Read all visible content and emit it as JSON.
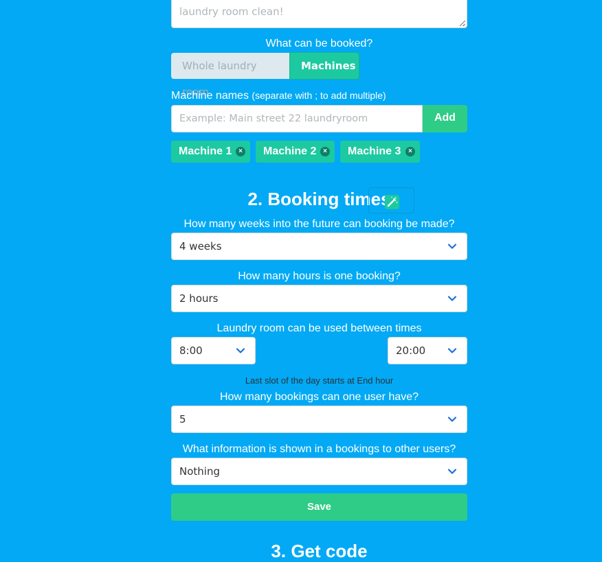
{
  "description_field": {
    "visible_text": "laundry room clean!"
  },
  "bookable": {
    "question": "What can be booked?",
    "options": [
      "Whole laundry room",
      "Machines"
    ],
    "selected": "Machines"
  },
  "machine_names": {
    "label": "Machine names",
    "label_hint": "(separate with ; to add multiple)",
    "placeholder": "Example: Main street 22 laundryroom",
    "add_label": "Add",
    "tags": [
      {
        "label": "Machine 1",
        "remove": "×"
      },
      {
        "label": "Machine 2",
        "remove": "×"
      },
      {
        "label": "Machine 3",
        "remove": "×"
      }
    ]
  },
  "booking_times": {
    "title": "2. Booking times",
    "weeks_question": "How many weeks into the future can booking be made?",
    "weeks_value": "4 weeks",
    "hours_question": "How many hours is one booking?",
    "hours_value": "2 hours",
    "times_question": "Laundry room can be used between times",
    "start_time": "8:00",
    "end_time": "20:00",
    "times_hint": "Last slot of the day starts at End hour",
    "max_bookings_question": "How many bookings can one user have?",
    "max_bookings_value": "5",
    "info_question": "What information is shown in a bookings to other users?",
    "info_value": "Nothing",
    "save_label": "Save"
  },
  "get_code": {
    "title": "3. Get code"
  },
  "icons": {
    "wand": "magic-wand-icon",
    "chevron": "chevron-down-icon",
    "remove": "close-icon"
  },
  "colors": {
    "background": "#03a9f4",
    "accent_teal": "#1dc9a0",
    "accent_green": "#2ecc87",
    "chevron_blue": "#1e6fd9"
  }
}
